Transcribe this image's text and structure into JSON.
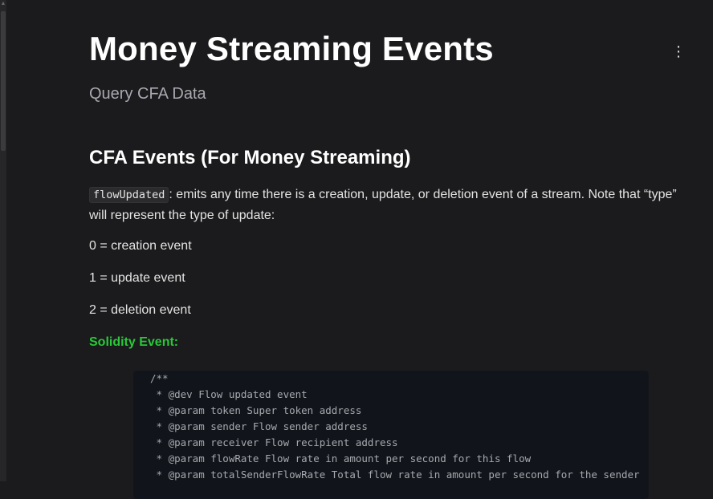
{
  "page": {
    "title": "Money Streaming Events",
    "subtitle": "Query CFA Data"
  },
  "toolbar": {
    "more_icon": "⋮"
  },
  "section": {
    "heading": "CFA Events (For Money Streaming)",
    "intro_code": "flowUpdated",
    "intro_text": ": emits any time there is a creation, update, or deletion event of a stream. Note that “type” will represent the type of update:",
    "events": [
      "0 = creation event",
      "1 = update event",
      "2 = deletion event"
    ],
    "solidity_label": "Solidity Event:"
  },
  "code_block": {
    "lines": [
      "/**",
      " * @dev Flow updated event",
      " * @param token Super token address",
      " * @param sender Flow sender address",
      " * @param receiver Flow recipient address",
      " * @param flowRate Flow rate in amount per second for this flow",
      " * @param totalSenderFlowRate Total flow rate in amount per second for the sender"
    ]
  },
  "colors": {
    "background": "#1b1b1d",
    "solidity_label": "#28c838",
    "code_background": "#11151b"
  }
}
